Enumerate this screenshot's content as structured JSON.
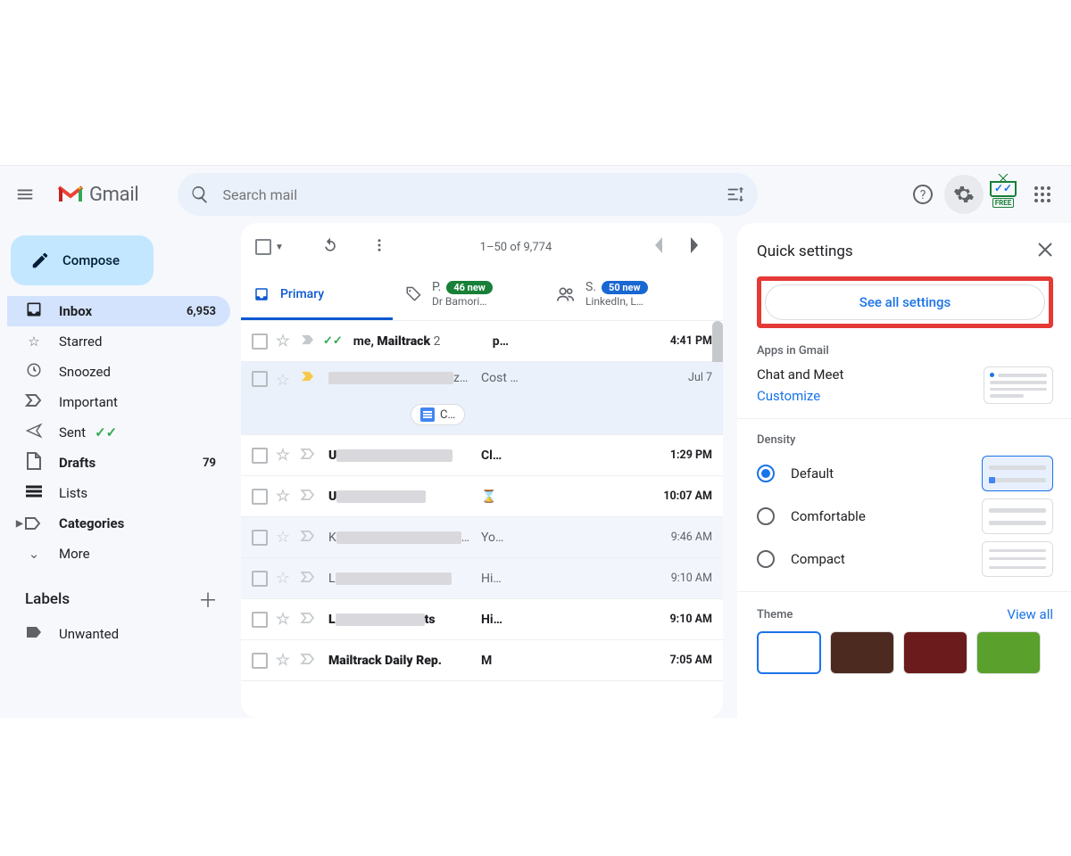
{
  "header": {
    "product": "Gmail",
    "search_placeholder": "Search mail",
    "extension_label": "FREE"
  },
  "compose_label": "Compose",
  "nav": {
    "inbox": {
      "label": "Inbox",
      "count": "6,953"
    },
    "starred": {
      "label": "Starred"
    },
    "snoozed": {
      "label": "Snoozed"
    },
    "important": {
      "label": "Important"
    },
    "sent": {
      "label": "Sent"
    },
    "drafts": {
      "label": "Drafts",
      "count": "79"
    },
    "lists": {
      "label": "Lists"
    },
    "categories": {
      "label": "Categories"
    },
    "more": {
      "label": "More"
    }
  },
  "labels": {
    "heading": "Labels",
    "items": {
      "unwanted": "Unwanted"
    }
  },
  "toolbar": {
    "range": "1–50 of 9,774"
  },
  "tabs": {
    "primary": {
      "label": "Primary"
    },
    "promotions": {
      "short": "P.",
      "badge": "46 new",
      "sub": "Dr Bamori…"
    },
    "social": {
      "short": "S.",
      "badge": "50 new",
      "sub": "LinkedIn, L…"
    }
  },
  "messages": [
    {
      "from_html": "me, <b>Mailtrack</b> <span style='font-weight:400;color:#5f6368'>2</span>",
      "subject": "p…",
      "time": "4:41 PM",
      "unread": true,
      "tracked": true,
      "important": false
    },
    {
      "from_redact": 155,
      "from_suffix": "z…",
      "subject": "Cost …",
      "time": "Jul 7",
      "unread": false,
      "important": true,
      "attachment": "C…"
    },
    {
      "from_prefix": "U",
      "from_redact": 130,
      "subject": "Cl…",
      "time": "1:29 PM",
      "unread": true
    },
    {
      "from_prefix": "U",
      "from_redact": 100,
      "subject_icon": "⌛",
      "subject": "",
      "time": "10:07 AM",
      "unread": true
    },
    {
      "from_prefix": "K",
      "from_redact": 150,
      "from_suffix": "…",
      "subject": "Yo…",
      "time": "9:46 AM",
      "unread": false
    },
    {
      "from_prefix": "L",
      "from_redact": 140,
      "subject": "Hi…",
      "time": "9:10 AM",
      "unread": false
    },
    {
      "from_prefix": "L",
      "from_redact": 100,
      "from_suffix": "ts",
      "subject": "Hi…",
      "time": "9:10 AM",
      "unread": true
    },
    {
      "from_html": "<b>Mailtrack Daily Rep.</b>",
      "subject": "M",
      "time": "7:05 AM",
      "unread": true
    }
  ],
  "quick_settings": {
    "title": "Quick settings",
    "see_all": "See all settings",
    "apps_heading": "Apps in Gmail",
    "chat_meet": "Chat and Meet",
    "customize": "Customize",
    "density_heading": "Density",
    "density": {
      "default": "Default",
      "comfortable": "Comfortable",
      "compact": "Compact"
    },
    "theme_heading": "Theme",
    "view_all": "View all"
  }
}
